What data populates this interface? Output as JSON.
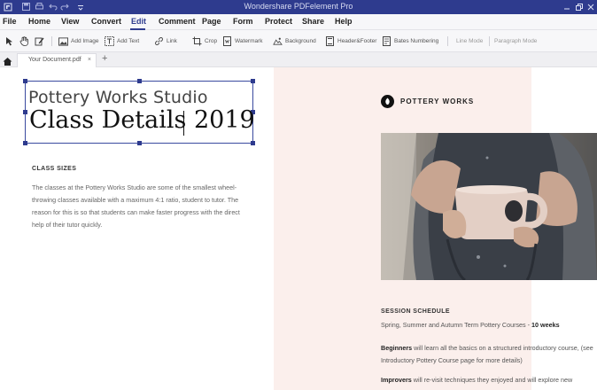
{
  "app": {
    "title": "Wondershare PDFelement Pro"
  },
  "menu": {
    "items": [
      {
        "label": "File"
      },
      {
        "label": "Home"
      },
      {
        "label": "View"
      },
      {
        "label": "Convert"
      },
      {
        "label": "Edit"
      },
      {
        "label": "Comment"
      },
      {
        "label": "Page"
      },
      {
        "label": "Form"
      },
      {
        "label": "Protect"
      },
      {
        "label": "Share"
      },
      {
        "label": "Help"
      }
    ],
    "active": "Edit"
  },
  "toolbar": {
    "add_image": "Add Image",
    "add_text": "Add Text",
    "link": "Link",
    "crop": "Crop",
    "watermark": "Watermark",
    "background": "Background",
    "header_footer": "Header&Footer",
    "bates_numbering": "Bates Numbering",
    "line_mode": "Line Mode",
    "paragraph_mode": "Paragraph Mode"
  },
  "tabs": {
    "document_tab": "Your Document.pdf",
    "close_glyph": "×",
    "new_tab_glyph": "+"
  },
  "document": {
    "subtitle": "Pottery Works Studio",
    "heading": "Class Details 2019",
    "class_sizes": {
      "heading": "CLASS SIZES",
      "body": "The classes at the Pottery Works Studio are some of the smallest wheel-throwing classes available with a maximum 4:1 ratio, student to tutor. The reason for this is so that students can make faster progress with the direct help of their tutor quickly."
    },
    "brand": {
      "name": "POTTERY WORKS"
    },
    "schedule": {
      "heading": "SESSION SCHEDULE",
      "line1_text": "Spring, Summer and Autumn Term Pottery Courses - ",
      "line1_bold": "10 weeks",
      "beginners_bold": "Beginners",
      "beginners_text": " will learn all the basics on a structured introductory course, (see Introductory Pottery Course page for more details)",
      "improvers_bold": "Improvers",
      "improvers_text": " will re-visit techniques they enjoyed and will explore new"
    }
  },
  "colors": {
    "titlebar": "#2e3b8e",
    "accent": "#2e3b8e",
    "page_pink": "#fbefec"
  },
  "icons": {
    "app": "pdfelement-logo-icon",
    "save": "save-icon",
    "print": "print-icon",
    "undo": "undo-icon",
    "redo": "redo-icon",
    "home": "home-icon"
  }
}
